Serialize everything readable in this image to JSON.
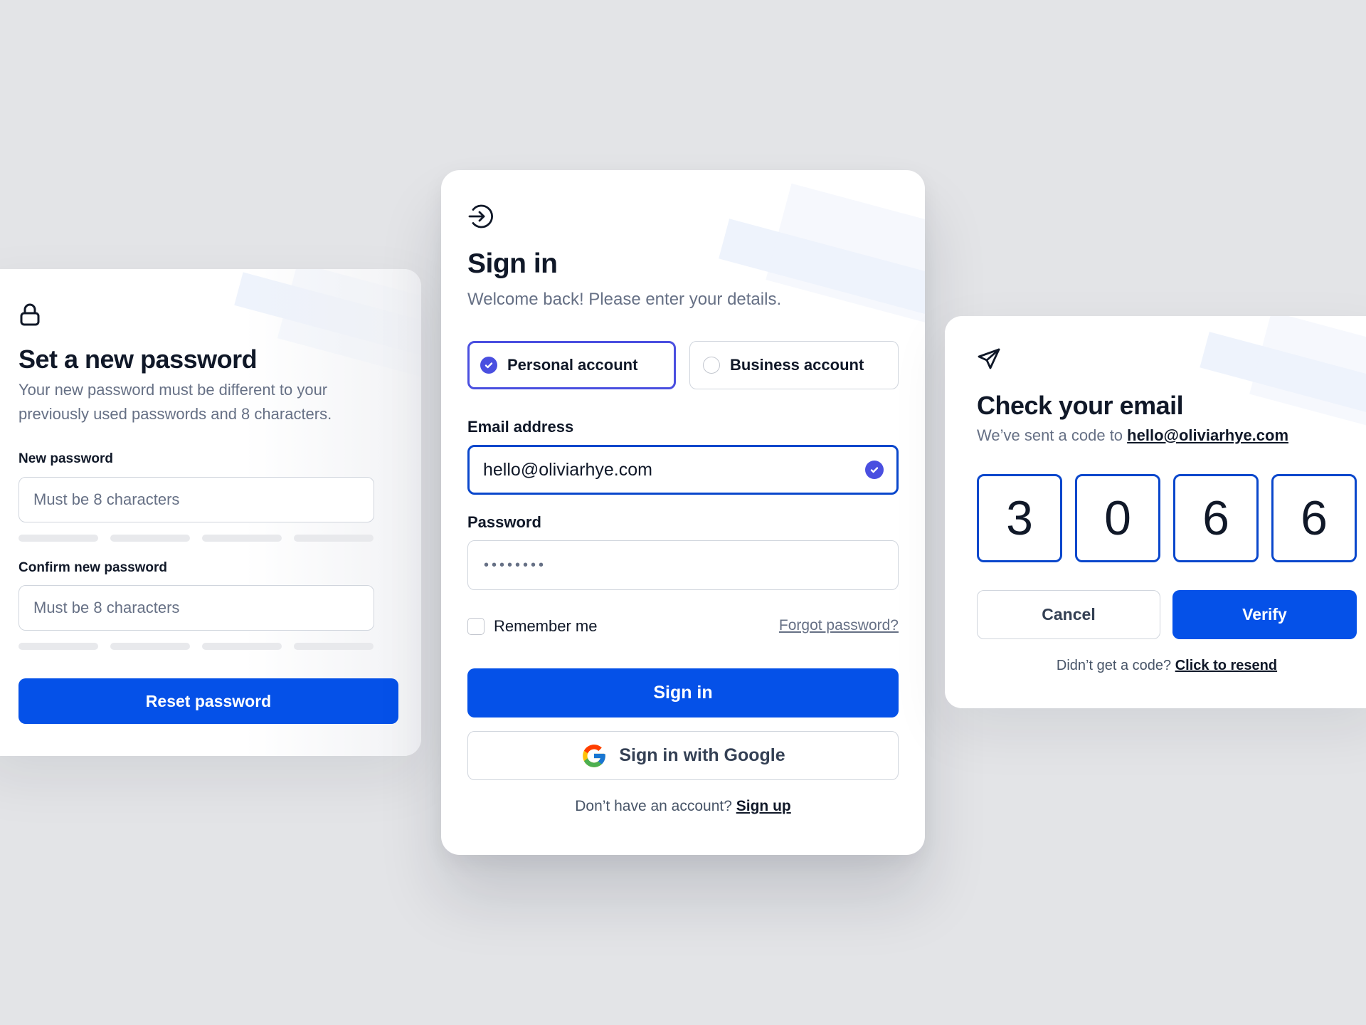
{
  "reset_card": {
    "title": "Set a new password",
    "subtitle": "Your new password must be different to your previously used passwords and 8 characters.",
    "new_password_label": "New password",
    "new_password_placeholder": "Must be 8 characters",
    "confirm_password_label": "Confirm new password",
    "confirm_password_placeholder": "Must be 8 characters",
    "submit_label": "Reset password",
    "icon": "lock-icon"
  },
  "signin_card": {
    "title": "Sign in",
    "subtitle": "Welcome back! Please enter your details.",
    "icon": "sign-in-arrow-icon",
    "account_types": {
      "personal": "Personal account",
      "business": "Business account",
      "selected": "personal"
    },
    "email_label": "Email address",
    "email_value": "hello@oliviarhye.com",
    "password_label": "Password",
    "password_value": "••••••••",
    "remember_label": "Remember me",
    "remember_checked": false,
    "forgot_label": "Forgot password?",
    "submit_label": "Sign in",
    "google_label": "Sign in with Google",
    "footer_prompt": "Don’t have an account?",
    "footer_link": "Sign up"
  },
  "email_card": {
    "title": "Check your email",
    "subtitle_prefix": "We’ve sent a code to",
    "email": "hello@oliviarhye.com",
    "icon": "send-icon",
    "code_digits": [
      "3",
      "0",
      "6",
      "6"
    ],
    "cancel_label": "Cancel",
    "verify_label": "Verify",
    "resend_prompt": "Didn’t get a code?",
    "resend_link": "Click to resend"
  },
  "colors": {
    "background": "#e3e4e7",
    "primary": "#0551e8",
    "focus_border": "#0a47cc",
    "radio_accent": "#4a4fe0",
    "text": "#101828",
    "muted_text": "#667085"
  }
}
